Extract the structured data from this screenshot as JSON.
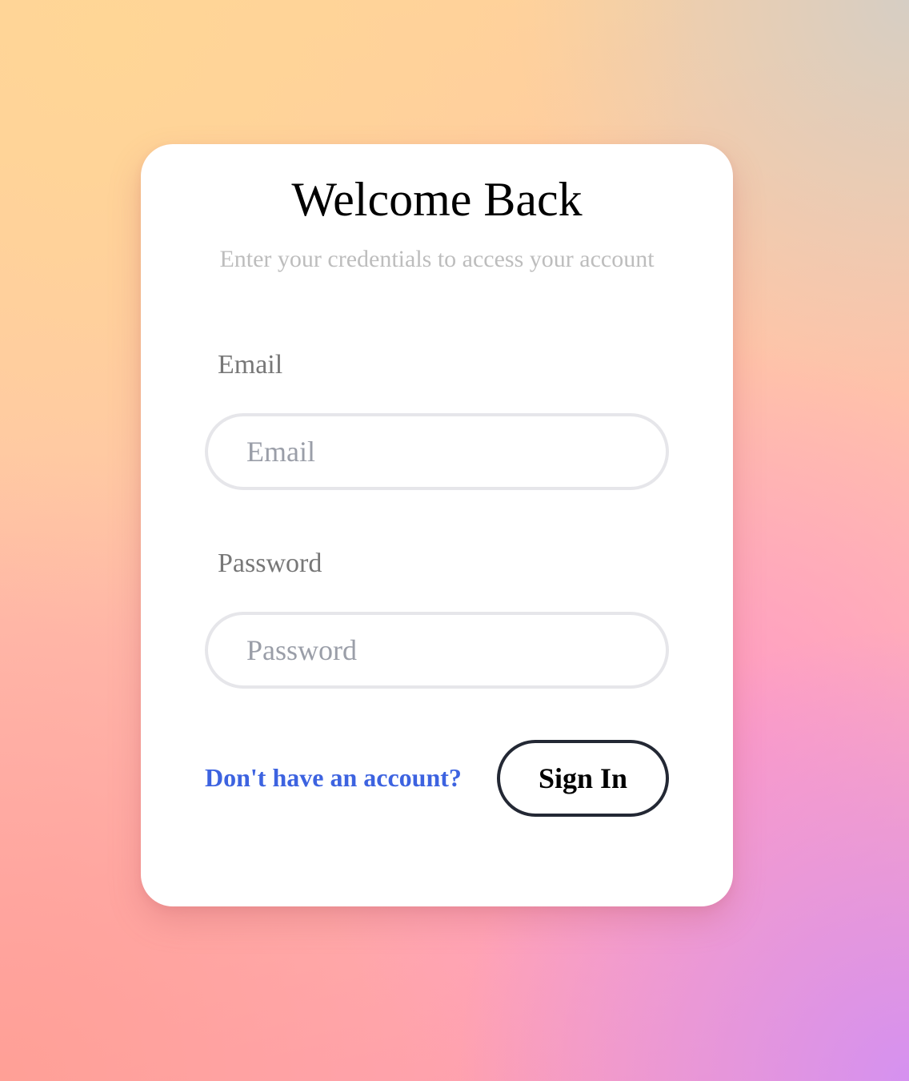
{
  "login": {
    "title": "Welcome Back",
    "subtitle": "Enter your credentials to access your account",
    "email": {
      "label": "Email",
      "placeholder": "Email",
      "value": ""
    },
    "password": {
      "label": "Password",
      "placeholder": "Password",
      "value": ""
    },
    "signup_link": "Don't have an account?",
    "submit_label": "Sign In"
  },
  "colors": {
    "link": "#3d63e0",
    "button_border": "#232834",
    "input_border": "#e6e6ea",
    "subtitle": "#bdbdbd",
    "label": "#777777"
  }
}
